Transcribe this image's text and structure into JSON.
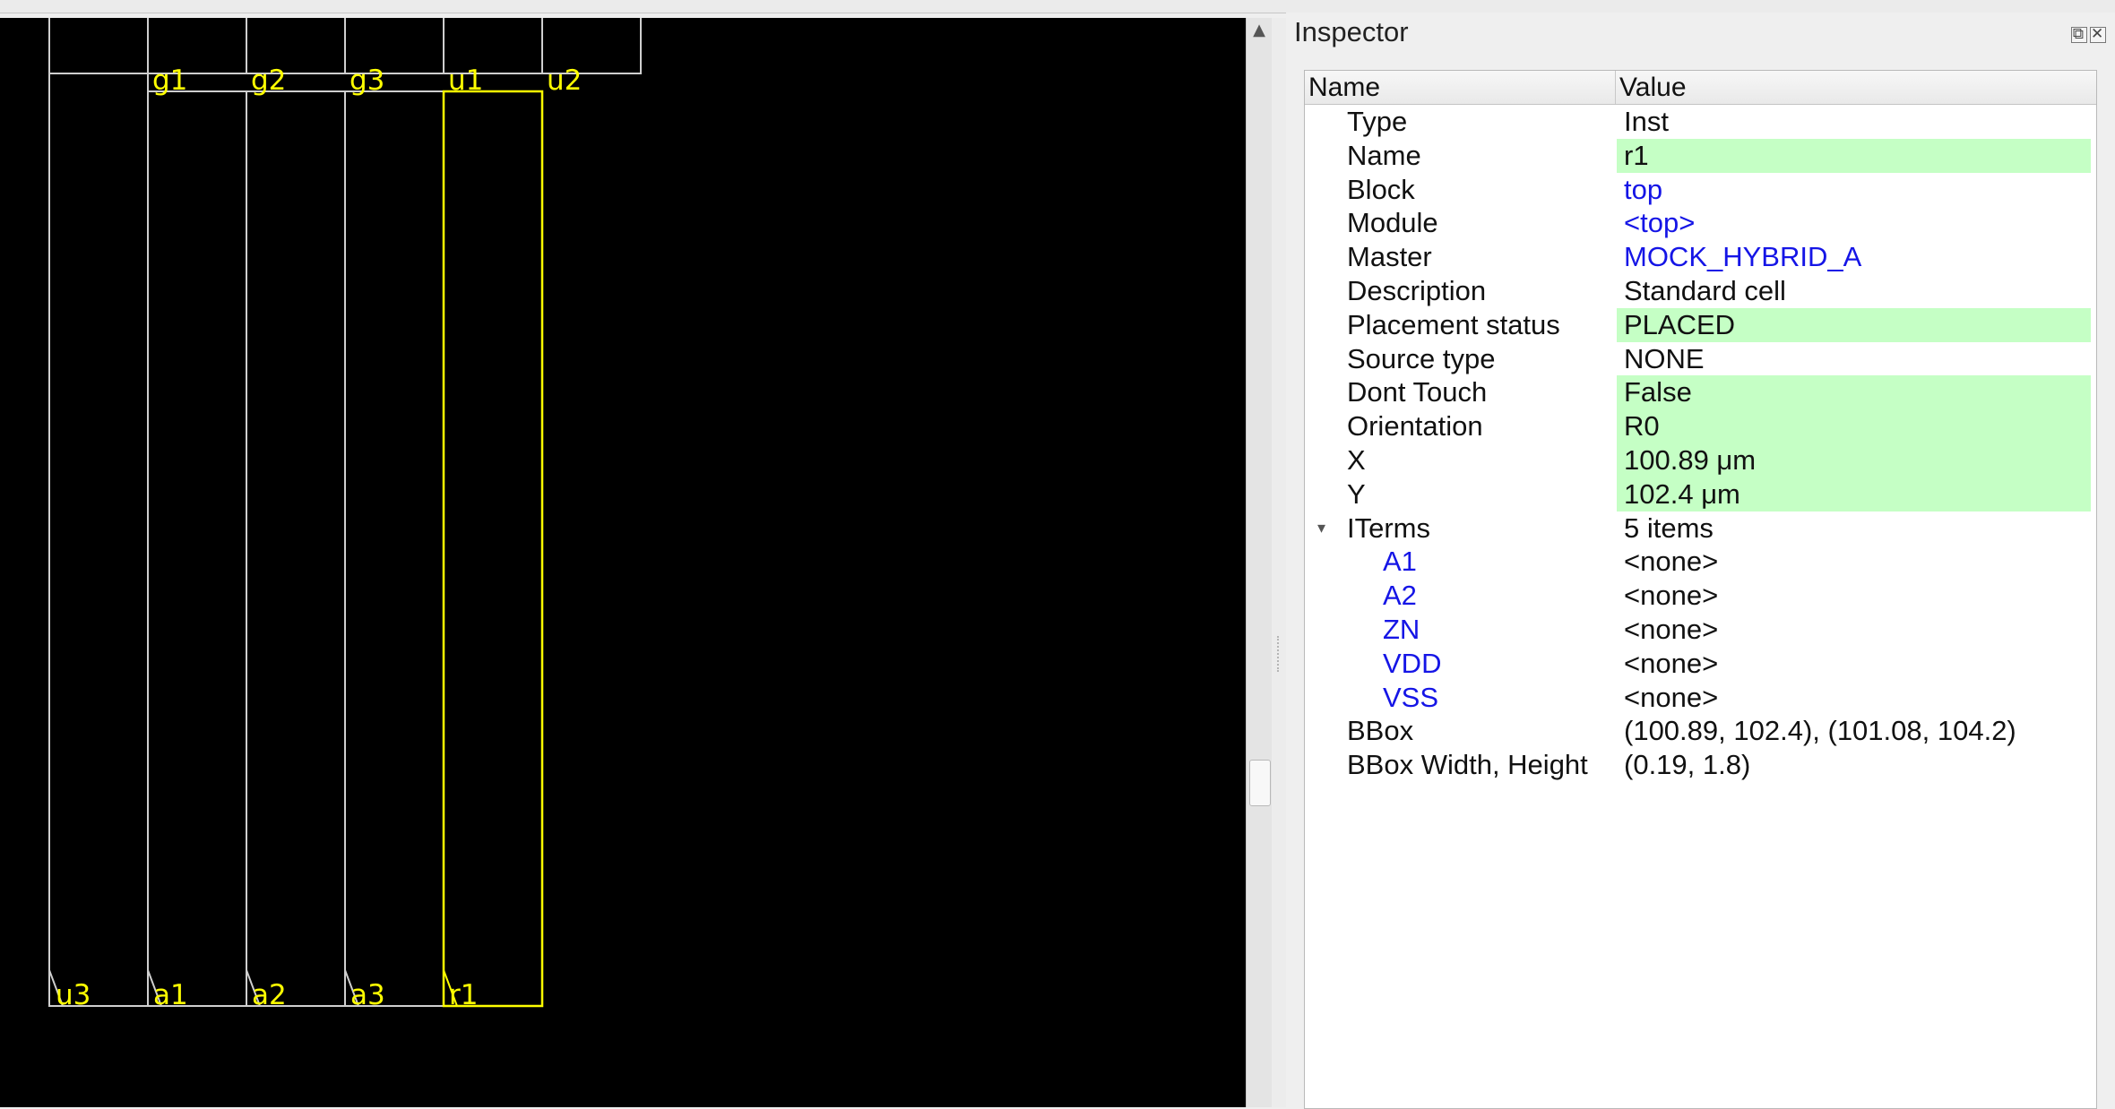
{
  "topstrip_text": "",
  "canvas": {
    "top_labels": [
      "g1",
      "g2",
      "g3",
      "u1",
      "u2"
    ],
    "bottom_labels": [
      "u3",
      "a1",
      "a2",
      "a3",
      "r1"
    ],
    "selected_instance": "r1",
    "colors": {
      "background": "#000000",
      "outline": "#cfcfcf",
      "highlight": "#ffff00"
    }
  },
  "inspector": {
    "title": "Inspector",
    "columns": {
      "name": "Name",
      "value": "Value"
    },
    "rows": [
      {
        "name": "Type",
        "value": "Inst"
      },
      {
        "name": "Name",
        "value": "r1",
        "editable": true
      },
      {
        "name": "Block",
        "value": "top",
        "link": true
      },
      {
        "name": "Module",
        "value": "<top>",
        "link": true
      },
      {
        "name": "Master",
        "value": "MOCK_HYBRID_A",
        "link": true
      },
      {
        "name": "Description",
        "value": "Standard cell"
      },
      {
        "name": "Placement status",
        "value": "PLACED",
        "editable": true
      },
      {
        "name": "Source type",
        "value": "NONE"
      },
      {
        "name": "Dont Touch",
        "value": "False",
        "editable": true
      },
      {
        "name": "Orientation",
        "value": "R0",
        "editable": true
      },
      {
        "name": "X",
        "value": "100.89 μm",
        "editable": true
      },
      {
        "name": "Y",
        "value": "102.4 μm",
        "editable": true
      },
      {
        "name": "ITerms",
        "value": "5 items",
        "expanded": true
      },
      {
        "name": "A1",
        "value": "<none>",
        "child": true
      },
      {
        "name": "A2",
        "value": "<none>",
        "child": true
      },
      {
        "name": "ZN",
        "value": "<none>",
        "child": true
      },
      {
        "name": "VDD",
        "value": "<none>",
        "child": true
      },
      {
        "name": "VSS",
        "value": "<none>",
        "child": true
      },
      {
        "name": "BBox",
        "value": "(100.89, 102.4), (101.08, 104.2)"
      },
      {
        "name": "BBox Width, Height",
        "value": "(0.19, 1.8)"
      }
    ],
    "colors": {
      "editable_bg": "#c5ffc5",
      "link": "#1515e6"
    }
  }
}
